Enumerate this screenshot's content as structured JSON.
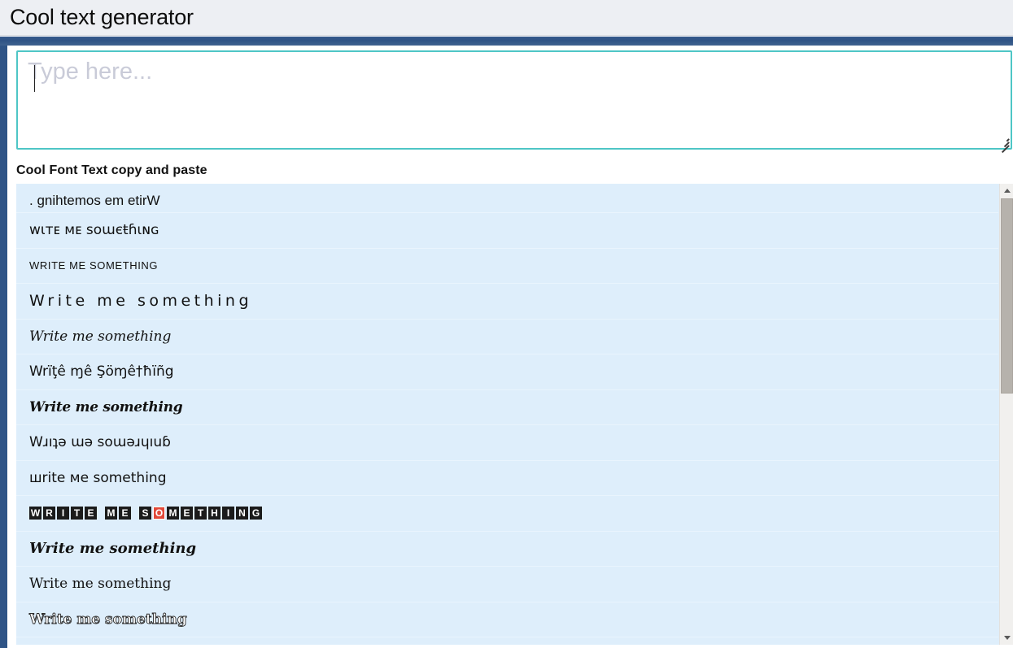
{
  "window": {
    "title": "Cool text generator"
  },
  "toolbar": {
    "glyph_row": [
      "☆",
      "↓",
      "○",
      "□",
      "▭",
      "⎔",
      "↓",
      "☆",
      "↓",
      "○",
      "□",
      "▭",
      "⎔",
      "▭",
      "↓",
      "☆"
    ]
  },
  "editor": {
    "placeholder": "Type here...",
    "value": "",
    "resize_handle": "resize-grip"
  },
  "section": {
    "title": "Cool Font Text copy and paste"
  },
  "results": [
    {
      "style": "reversed",
      "text": ". gnihtemos em etirW"
    },
    {
      "style": "flipped-mixed",
      "text": "ᴡɩᴛᴇ ᴍᴇ ѕᴏɯєŧɦιɴɢ"
    },
    {
      "style": "small-caps",
      "text": "WRITE ME SOMETHING"
    },
    {
      "style": "wide-spaced",
      "text": "Write me something"
    },
    {
      "style": "script-italic",
      "text": "Write me something"
    },
    {
      "style": "diacritics",
      "text": "Wrïţê ɱê Şöɱê†ħïñg"
    },
    {
      "style": "fraktur-bold",
      "text": "Write me something"
    },
    {
      "style": "upside-down",
      "text": "Wɹıʇǝ ɯǝ soɯǝɹɥıuɓ"
    },
    {
      "style": "curly",
      "text": "шrite ме something"
    },
    {
      "style": "squared-negative",
      "text": "WRITE ME SOMETHING",
      "letters": [
        "W",
        "R",
        "I",
        "T",
        "E",
        " ",
        "M",
        "E",
        " ",
        "S",
        "O",
        "M",
        "E",
        "T",
        "H",
        "I",
        "N",
        "G"
      ],
      "highlight_index": 10,
      "highlight_color": "#e2493a"
    },
    {
      "style": "bold-italic-serif",
      "text": "Write me something"
    },
    {
      "style": "fraktur",
      "text": "Write me something"
    },
    {
      "style": "fraktur-outline",
      "text": "Write me something"
    }
  ],
  "scrollbar": {
    "up_arrow": "scroll-up-icon",
    "down_arrow": "scroll-down-icon",
    "thumb_position_pct": 0,
    "thumb_size_pct": 45
  },
  "colors": {
    "header_bg": "#edeff3",
    "toolbar_blue": "#2f5385",
    "list_bg": "#deeefb",
    "textarea_border": "#4ec6c6",
    "rail": "#2f5486"
  }
}
